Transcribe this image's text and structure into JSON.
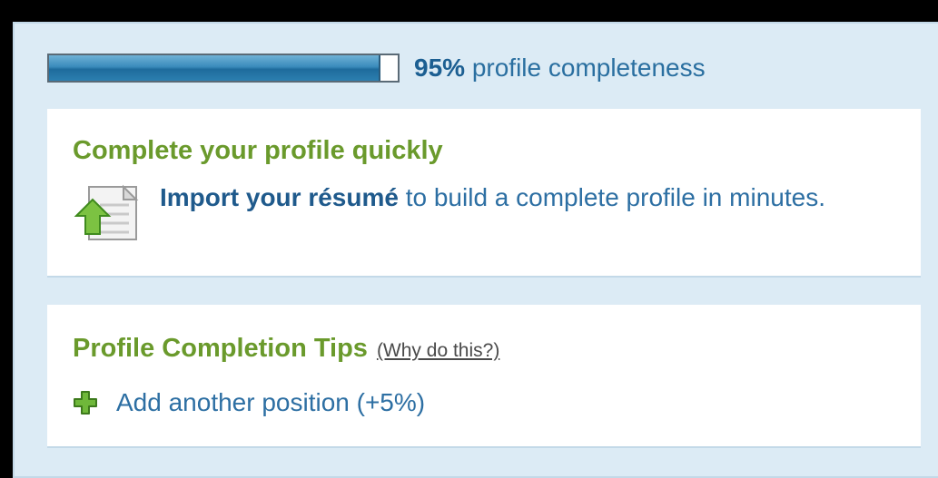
{
  "progress": {
    "fraction": 0.95,
    "percent_label": "95%",
    "label": " profile completeness"
  },
  "quick_card": {
    "title": "Complete your profile quickly",
    "import_link": "Import your résumé",
    "import_rest": " to build a complete profile in minutes.",
    "icon": "document-upload-icon"
  },
  "tips_card": {
    "title": "Profile Completion Tips",
    "why_link": "(Why do this?)",
    "tips": [
      {
        "icon": "plus-icon",
        "label": "Add another position (+5%)"
      }
    ]
  },
  "colors": {
    "panel_bg": "#dcebf5",
    "title_green": "#6a9a2c",
    "link_blue": "#2d6fa3",
    "bar_blue": "#2c7fb0"
  }
}
